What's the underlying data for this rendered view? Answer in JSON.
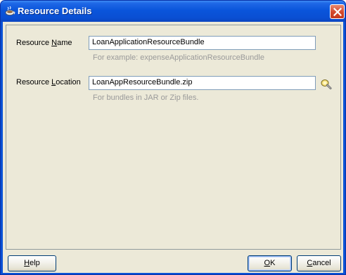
{
  "window": {
    "title": "Resource Details"
  },
  "form": {
    "resource_name": {
      "label_prefix": "Resource ",
      "label_mnemonic": "N",
      "label_suffix": "ame",
      "value": "LoanApplicationResourceBundle",
      "hint": "For example: expenseApplicationResourceBundle"
    },
    "resource_location": {
      "label_prefix": "Resource ",
      "label_mnemonic": "L",
      "label_suffix": "ocation",
      "value": "LoanAppResourceBundle.zip",
      "hint": "For bundles in JAR or Zip files."
    }
  },
  "buttons": {
    "help": {
      "mnemonic": "H",
      "rest": "elp"
    },
    "ok": {
      "mnemonic": "O",
      "rest": "K"
    },
    "cancel": {
      "mnemonic": "C",
      "rest": "ancel"
    }
  },
  "icons": {
    "title_icon": "coffee-cup-icon",
    "close": "close-icon",
    "browse": "flashlight-search-icon"
  },
  "colors": {
    "titlebar": "#0a55db",
    "dialog_bg": "#ece9d8",
    "close_button": "#d3472b",
    "hint_text": "#9a9a9a"
  }
}
